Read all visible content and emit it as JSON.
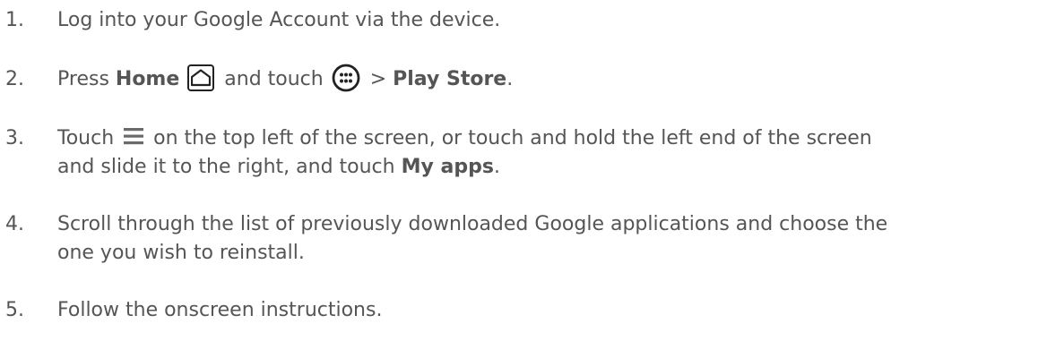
{
  "steps": [
    {
      "number": "1.",
      "text": "Log into your Google Account via the device."
    },
    {
      "number": "2.",
      "pre": "Press ",
      "home_label": "Home",
      "mid": " and touch ",
      "sep": " > ",
      "store_label": "Play Store",
      "end": "."
    },
    {
      "number": "3.",
      "pre": "Touch ",
      "line1_rest": " on the top left of the screen, or touch and hold the left end of the screen",
      "line2_pre": "and slide it to the right, and touch ",
      "my_apps_label": "My apps",
      "end": "."
    },
    {
      "number": "4.",
      "line1": "Scroll through the list of previously downloaded Google applications and choose the",
      "line2": "one you wish to reinstall."
    },
    {
      "number": "5.",
      "text": "Follow the onscreen instructions."
    }
  ],
  "icons": {
    "home": "home-icon",
    "apps": "apps-icon",
    "menu": "menu-icon"
  }
}
